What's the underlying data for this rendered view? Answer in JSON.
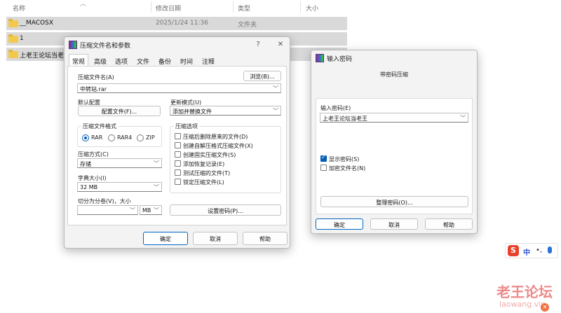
{
  "explorer": {
    "columns": {
      "name": "名称",
      "date": "修改日期",
      "type": "类型",
      "size": "大小"
    },
    "rows": [
      {
        "name": "__MACOSX",
        "date": "2025/1/24 11:36",
        "type": "文件夹"
      },
      {
        "name": "1",
        "date": "",
        "type": ""
      },
      {
        "name": "上老王论坛当老王",
        "date": "",
        "type": ""
      }
    ]
  },
  "archive_dialog": {
    "title": "压缩文件名和参数",
    "help_glyph": "?",
    "close_glyph": "✕",
    "tabs": [
      "常规",
      "高级",
      "选项",
      "文件",
      "备份",
      "时间",
      "注释"
    ],
    "archive_name_label": "压缩文件名(A)",
    "browse_label": "浏览(B)...",
    "archive_name_value": "中转站.rar",
    "default_profile_label": "默认配置",
    "profiles_button": "配置文件(F)...",
    "update_mode_label": "更新模式(U)",
    "update_mode_value": "添加并替换文件",
    "format_group": "压缩文件格式",
    "formats": [
      "RAR",
      "RAR4",
      "ZIP"
    ],
    "selected_format": "RAR",
    "options_group": "压缩选项",
    "options": [
      {
        "label": "压缩后删除原来的文件(D)",
        "checked": false
      },
      {
        "label": "创建自解压格式压缩文件(X)",
        "checked": false
      },
      {
        "label": "创建固实压缩文件(S)",
        "checked": false
      },
      {
        "label": "添加恢复记录(E)",
        "checked": false
      },
      {
        "label": "测试压缩的文件(T)",
        "checked": false
      },
      {
        "label": "锁定压缩文件(L)",
        "checked": false
      }
    ],
    "method_label": "压缩方式(C)",
    "method_value": "存储",
    "dict_label": "字典大小(I)",
    "dict_value": "32 MB",
    "split_label": "切分为分卷(V)，大小",
    "split_value": "",
    "split_unit": "MB",
    "set_password_button": "设置密码(P)...",
    "ok_button": "确定",
    "cancel_button": "取消",
    "help_button": "帮助"
  },
  "password_dialog": {
    "title": "输入密码",
    "subtitle": "带密码压缩",
    "password_label": "输入密码(E)",
    "password_value": "上老王论坛当老王",
    "show_password_label": "显示密码(S)",
    "show_password_checked": true,
    "encrypt_names_label": "加密文件名(N)",
    "encrypt_names_checked": false,
    "organize_button": "整理密码(O)...",
    "ok_button": "确定",
    "cancel_button": "取消",
    "help_button": "帮助"
  },
  "ime": {
    "zh_label": "中",
    "punct": "•,"
  },
  "watermark": {
    "line1": "老王论坛",
    "line2": "laowang.vip"
  },
  "icons": {
    "folder": "folder-icon",
    "winrar": "winrar-icon",
    "sort": "sort-up-icon",
    "chevron": "chevron-down-icon",
    "ime": "sogou-ime-icon",
    "mic": "microphone-icon"
  }
}
